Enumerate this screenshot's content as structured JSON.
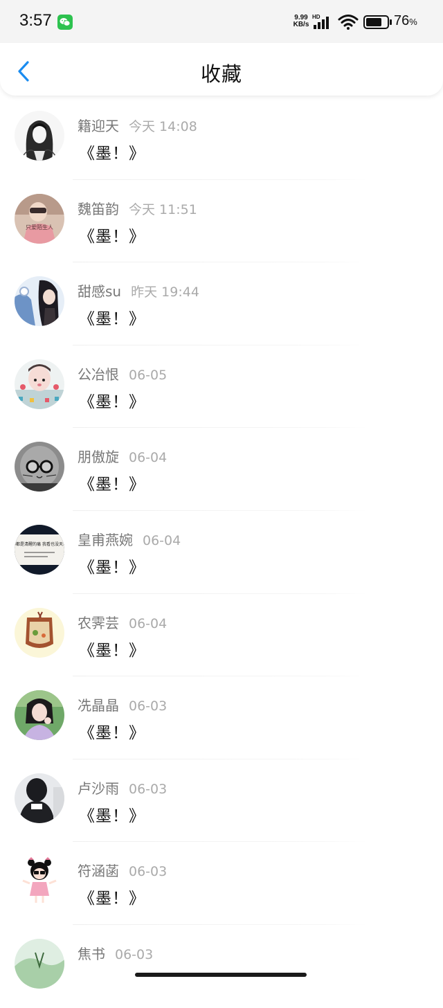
{
  "status_bar": {
    "time": "3:57",
    "net_speed_value": "9.99",
    "net_speed_unit": "KB/s",
    "network_label": "HD",
    "battery_percent": "76",
    "battery_unit": "%",
    "battery_level": 0.76
  },
  "header": {
    "title": "收藏",
    "back_icon": "chevron-left-icon",
    "accent_color": "#1a8cf0"
  },
  "favorites": [
    {
      "name": "籍迎天",
      "time": "今天 14:08",
      "message": "《墨！》"
    },
    {
      "name": "魏笛韵",
      "time": "今天 11:51",
      "message": "《墨！》"
    },
    {
      "name": "甜感su",
      "time": "昨天 19:44",
      "message": "《墨！》"
    },
    {
      "name": "公冶恨",
      "time": "06-05",
      "message": "《墨！》"
    },
    {
      "name": "朋傲旋",
      "time": "06-04",
      "message": "《墨！》"
    },
    {
      "name": "皇甫燕婉",
      "time": "06-04",
      "message": "《墨！》"
    },
    {
      "name": "农霁芸",
      "time": "06-04",
      "message": "《墨！》"
    },
    {
      "name": "冼晶晶",
      "time": "06-03",
      "message": "《墨！》"
    },
    {
      "name": "卢沙雨",
      "time": "06-03",
      "message": "《墨！》"
    },
    {
      "name": "符涵菡",
      "time": "06-03",
      "message": "《墨！》"
    },
    {
      "name": "焦书",
      "time": "06-03",
      "message": ""
    }
  ],
  "avatar_texts": {
    "item2": "只爱陌生人",
    "item6": "哪都是清醒的痛 我看也没天本"
  }
}
